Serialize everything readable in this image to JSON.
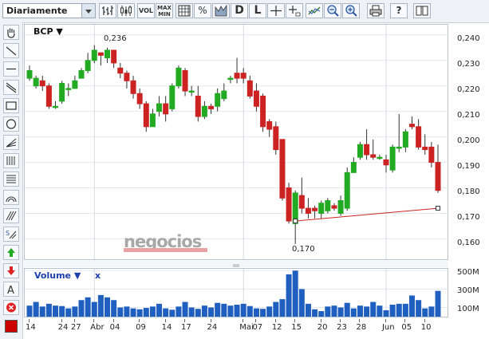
{
  "toolbar": {
    "period": "Diariamente",
    "vol_label": "VOL",
    "maxmin_label_1": "MAX",
    "maxmin_label_2": "MIN",
    "percent_label": "%",
    "d_label": "D",
    "l_label": "L",
    "help_label": "?"
  },
  "chart": {
    "ticker": "BCP",
    "high_annotation": "0,236",
    "low_annotation": "0,170",
    "watermark": "negocios",
    "y_ticks": [
      "0,240",
      "0,230",
      "0,220",
      "0,210",
      "0,200",
      "0,190",
      "0,180",
      "0,170",
      "0,160"
    ],
    "x_ticks": [
      "14",
      "24",
      "27",
      "Abr",
      "04",
      "09",
      "14",
      "17",
      "24",
      "Mai",
      "07",
      "12",
      "15",
      "20",
      "23",
      "28",
      "Jun",
      "05",
      "10"
    ]
  },
  "volume": {
    "label": "Volume",
    "close_label": "x",
    "y_ticks": [
      "500M",
      "300M",
      "100M"
    ]
  },
  "colors": {
    "up": "#22aa22",
    "down": "#cc2222",
    "volume": "#1f5fbf",
    "trendline": "#cc2222"
  },
  "chart_data": {
    "type": "candlestick",
    "x": [
      "14",
      "",
      "",
      "",
      "",
      "24",
      "",
      "27",
      "",
      "",
      "Abr",
      "",
      "",
      "04",
      "",
      "",
      "",
      "09",
      "",
      "",
      "",
      "14",
      "",
      "",
      "17",
      "",
      "",
      "",
      "24",
      "",
      "",
      "",
      "",
      "Mai",
      "",
      "07",
      "",
      "",
      "12",
      "",
      "",
      "15",
      "",
      "",
      "",
      "20",
      "",
      "",
      "23",
      "",
      "",
      "28",
      "",
      "",
      "",
      "Jun",
      "",
      "",
      "05",
      "",
      "",
      "10",
      ""
    ],
    "candles": [
      [
        0.223,
        0.226,
        0.228,
        0.222
      ],
      [
        0.22,
        0.223,
        0.224,
        0.219
      ],
      [
        0.222,
        0.22,
        0.224,
        0.218
      ],
      [
        0.22,
        0.212,
        0.221,
        0.211
      ],
      [
        0.212,
        0.212,
        0.214,
        0.211
      ],
      [
        0.214,
        0.221,
        0.222,
        0.213
      ],
      [
        0.219,
        0.219,
        0.221,
        0.216
      ],
      [
        0.219,
        0.222,
        0.224,
        0.219
      ],
      [
        0.223,
        0.226,
        0.227,
        0.223
      ],
      [
        0.226,
        0.23,
        0.233,
        0.225
      ],
      [
        0.23,
        0.234,
        0.236,
        0.229
      ],
      [
        0.233,
        0.232,
        0.233,
        0.228
      ],
      [
        0.231,
        0.234,
        0.235,
        0.229
      ],
      [
        0.234,
        0.229,
        0.234,
        0.227
      ],
      [
        0.227,
        0.225,
        0.229,
        0.223
      ],
      [
        0.225,
        0.222,
        0.226,
        0.219
      ],
      [
        0.222,
        0.217,
        0.224,
        0.215
      ],
      [
        0.217,
        0.213,
        0.219,
        0.211
      ],
      [
        0.213,
        0.204,
        0.214,
        0.202
      ],
      [
        0.204,
        0.209,
        0.211,
        0.204
      ],
      [
        0.21,
        0.213,
        0.216,
        0.208
      ],
      [
        0.213,
        0.209,
        0.216,
        0.206
      ],
      [
        0.211,
        0.22,
        0.221,
        0.21
      ],
      [
        0.22,
        0.227,
        0.228,
        0.219
      ],
      [
        0.226,
        0.218,
        0.227,
        0.216
      ],
      [
        0.218,
        0.218,
        0.22,
        0.216
      ],
      [
        0.216,
        0.208,
        0.22,
        0.206
      ],
      [
        0.208,
        0.212,
        0.214,
        0.207
      ],
      [
        0.212,
        0.211,
        0.213,
        0.209
      ],
      [
        0.212,
        0.217,
        0.219,
        0.21
      ],
      [
        0.215,
        0.218,
        0.221,
        0.214
      ],
      [
        0.223,
        0.223,
        0.224,
        0.221
      ],
      [
        0.225,
        0.223,
        0.231,
        0.221
      ],
      [
        0.225,
        0.223,
        0.227,
        0.221
      ],
      [
        0.222,
        0.216,
        0.224,
        0.215
      ],
      [
        0.218,
        0.212,
        0.221,
        0.21
      ],
      [
        0.216,
        0.204,
        0.217,
        0.202
      ],
      [
        0.206,
        0.203,
        0.207,
        0.2
      ],
      [
        0.204,
        0.195,
        0.206,
        0.193
      ],
      [
        0.199,
        0.176,
        0.199,
        0.175
      ],
      [
        0.18,
        0.167,
        0.182,
        0.166
      ],
      [
        0.166,
        0.178,
        0.179,
        0.158
      ],
      [
        0.177,
        0.172,
        0.184,
        0.17
      ],
      [
        0.172,
        0.17,
        0.176,
        0.168
      ],
      [
        0.172,
        0.171,
        0.173,
        0.168
      ],
      [
        0.17,
        0.174,
        0.175,
        0.168
      ],
      [
        0.171,
        0.175,
        0.176,
        0.17
      ],
      [
        0.173,
        0.172,
        0.174,
        0.171
      ],
      [
        0.17,
        0.175,
        0.177,
        0.169
      ],
      [
        0.172,
        0.186,
        0.188,
        0.171
      ],
      [
        0.186,
        0.19,
        0.192,
        0.187
      ],
      [
        0.192,
        0.197,
        0.198,
        0.191
      ],
      [
        0.197,
        0.193,
        0.203,
        0.191
      ],
      [
        0.193,
        0.192,
        0.199,
        0.191
      ],
      [
        0.192,
        0.192,
        0.193,
        0.191
      ],
      [
        0.191,
        0.189,
        0.193,
        0.186
      ],
      [
        0.187,
        0.196,
        0.197,
        0.186
      ],
      [
        0.196,
        0.196,
        0.209,
        0.194
      ],
      [
        0.196,
        0.202,
        0.203,
        0.194
      ],
      [
        0.205,
        0.204,
        0.208,
        0.203
      ],
      [
        0.204,
        0.196,
        0.207,
        0.195
      ],
      [
        0.196,
        0.195,
        0.201,
        0.193
      ],
      [
        0.196,
        0.19,
        0.198,
        0.188
      ],
      [
        0.19,
        0.179,
        0.197,
        0.178
      ]
    ],
    "volume_millions": [
      120,
      160,
      110,
      140,
      120,
      115,
      90,
      110,
      180,
      210,
      160,
      235,
      210,
      180,
      100,
      110,
      90,
      80,
      95,
      110,
      140,
      90,
      75,
      110,
      160,
      100,
      85,
      120,
      100,
      150,
      140,
      120,
      130,
      140,
      115,
      90,
      85,
      110,
      160,
      190,
      460,
      500,
      300,
      140,
      80,
      60,
      110,
      120,
      100,
      150,
      90,
      120,
      110,
      160,
      120,
      70,
      130,
      140,
      140,
      230,
      180,
      90,
      110,
      280
    ],
    "ylim": [
      0.152,
      0.244
    ],
    "volume_ylim": [
      0,
      520
    ],
    "trendline": [
      [
        0.167,
        0.172
      ]
    ],
    "annotations": [
      {
        "text": "0,236",
        "value": 0.236
      },
      {
        "text": "0,170",
        "value": 0.17
      }
    ]
  }
}
